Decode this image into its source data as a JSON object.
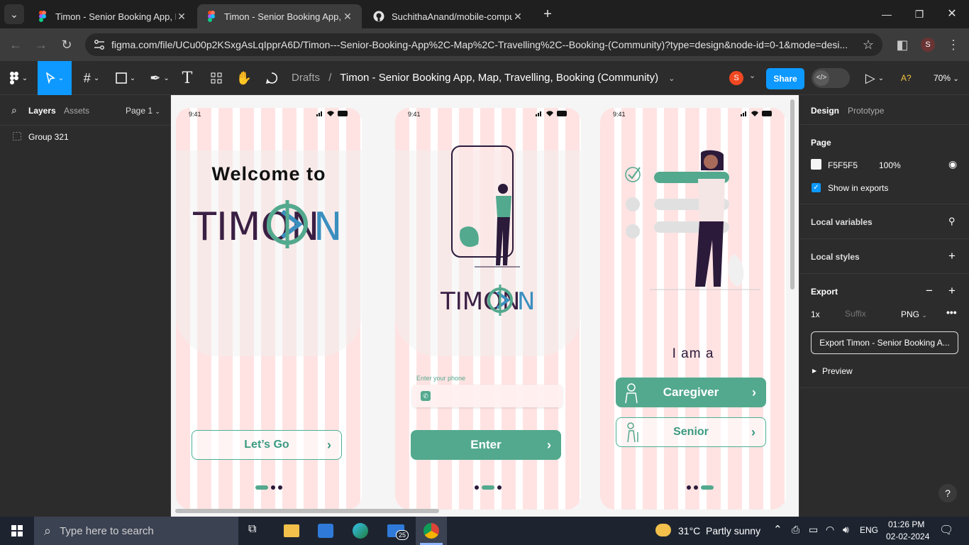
{
  "browser": {
    "tabs": [
      {
        "title": "Timon - Senior Booking App, M",
        "close": "✕"
      },
      {
        "title": "Timon - Senior Booking App, M",
        "close": "✕"
      },
      {
        "title": "SuchithaAnand/mobile-comput",
        "close": "✕"
      }
    ],
    "new_tab": "+",
    "url": "figma.com/file/UCu00p2KSxgAsLqIpprA6D/Timon---Senior-Booking-App%2C-Map%2C-Travelling%2C--Booking-(Community)?type=design&node-id=0-1&mode=desi...",
    "profile_initial": "S"
  },
  "figma": {
    "breadcrumb_root": "Drafts",
    "breadcrumb_sep": "/",
    "file_name": "Timon - Senior Booking App, Map, Travelling, Booking (Community)",
    "user_initial": "S",
    "share_label": "Share",
    "zoom": "70%",
    "font_warning": "A?",
    "left": {
      "tab_layers": "Layers",
      "tab_assets": "Assets",
      "page_select": "Page 1",
      "layers": [
        "Group 321"
      ]
    },
    "right": {
      "tab_design": "Design",
      "tab_prototype": "Prototype",
      "page_title": "Page",
      "page_color": "F5F5F5",
      "page_opacity": "100%",
      "show_in_exports": "Show in exports",
      "local_variables": "Local variables",
      "local_styles": "Local styles",
      "export_title": "Export",
      "export_scale": "1x",
      "export_suffix_placeholder": "Suffix",
      "export_format": "PNG",
      "export_button": "Export Timon - Senior Booking A...",
      "preview": "Preview"
    },
    "help": "?"
  },
  "screens": {
    "time": "9:41",
    "s1": {
      "welcome": "Welcome to",
      "logo": "TIMON",
      "button": "Let’s Go"
    },
    "s2": {
      "logo": "TIMON",
      "phone_label": "Enter your phone",
      "button": "Enter"
    },
    "s3": {
      "heading": "I am a",
      "option1": "Caregiver",
      "option2": "Senior"
    }
  },
  "taskbar": {
    "search_placeholder": "Type here to search",
    "weather": "31°C  Partly sunny",
    "language": "ENG",
    "time": "01:26 PM",
    "date": "02-02-2024",
    "mail_badge": "25"
  },
  "colors": {
    "teal": "#53a98e",
    "plum": "#2b1a3a",
    "stripe_pink": "#ffe3e3",
    "figma_blue": "#0d99ff"
  }
}
